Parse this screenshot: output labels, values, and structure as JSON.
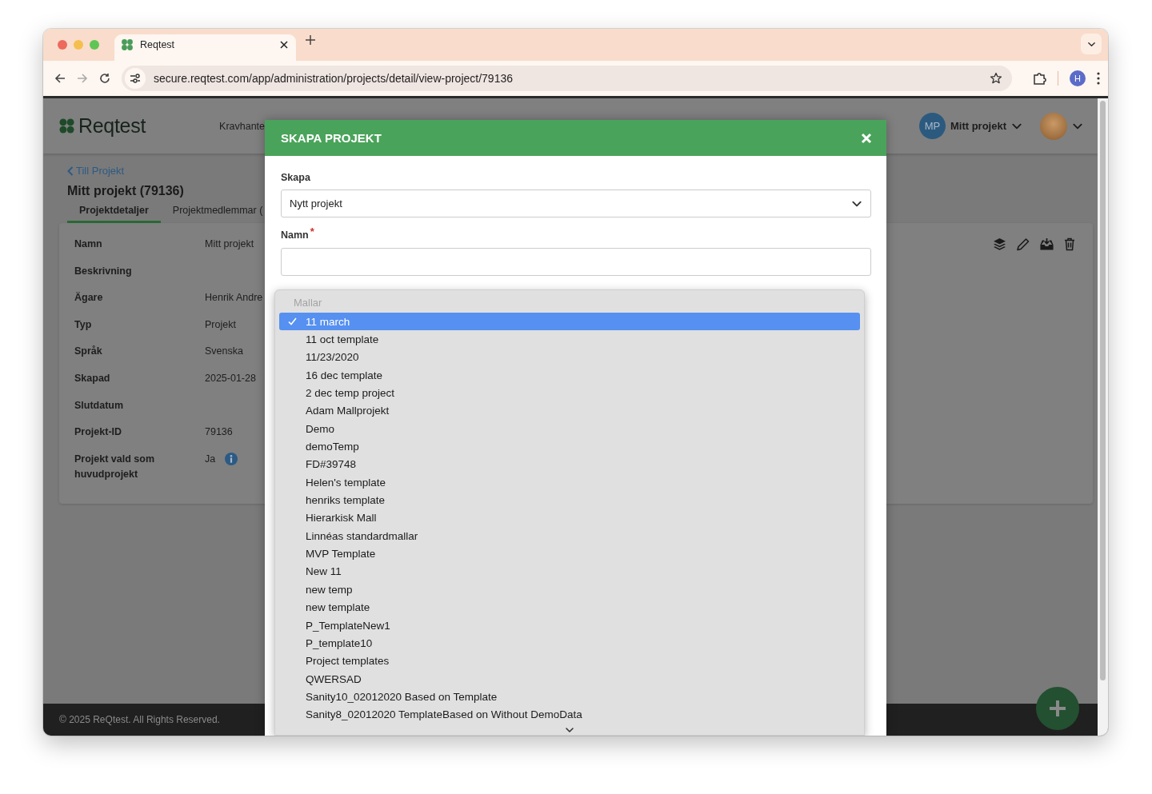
{
  "browser": {
    "tab_title": "Reqtest",
    "url": "secure.reqtest.com/app/administration/projects/detail/view-project/79136",
    "profile_initial": "H"
  },
  "header": {
    "logo": "Reqtest",
    "nav_item": "Kravhante",
    "project_initials": "MP",
    "project_name": "Mitt projekt"
  },
  "back_link": "Till Projekt",
  "page_title": "Mitt projekt (79136)",
  "tabs": [
    {
      "label": "Projektdetaljer",
      "selected": true
    },
    {
      "label": "Projektmedlemmar (",
      "selected": false
    }
  ],
  "details": [
    {
      "label": "Namn",
      "value": "Mitt projekt",
      "info_icon": false
    },
    {
      "label": "Beskrivning",
      "info_icon": false
    },
    {
      "label": "Ägare",
      "value": "Henrik Andre",
      "info_icon": false
    },
    {
      "label": "Typ",
      "value": "Projekt",
      "info_icon": false
    },
    {
      "label": "Språk",
      "value": "Svenska",
      "info_icon": false
    },
    {
      "label": "Skapad",
      "value": "2025-01-28",
      "info_icon": false
    },
    {
      "label": "Slutdatum",
      "info_icon": false
    },
    {
      "label": "Projekt-ID",
      "value": "79136",
      "info_icon": false
    },
    {
      "label": "Projekt vald som huvudprojekt",
      "value": "Ja",
      "info_icon": true
    }
  ],
  "footer": "© 2025 ReQtest. All Rights Reserved.",
  "modal": {
    "title": "SKAPA PROJEKT",
    "fields": [
      {
        "kind": "select",
        "label": "Skapa",
        "value": "Nytt projekt"
      },
      {
        "kind": "text",
        "label": "Namn",
        "required_mark": "*"
      }
    ]
  },
  "dropdown": {
    "group_label": "Mallar",
    "options": [
      {
        "label": "11 march",
        "selected": true
      },
      {
        "label": "11 oct template",
        "selected": false
      },
      {
        "label": "11/23/2020",
        "selected": false
      },
      {
        "label": "16 dec template",
        "selected": false
      },
      {
        "label": "2 dec temp project",
        "selected": false
      },
      {
        "label": "Adam Mallprojekt",
        "selected": false
      },
      {
        "label": "Demo",
        "selected": false
      },
      {
        "label": "demoTemp",
        "selected": false
      },
      {
        "label": "FD#39748",
        "selected": false
      },
      {
        "label": "Helen's template",
        "selected": false
      },
      {
        "label": "henriks template",
        "selected": false
      },
      {
        "label": "Hierarkisk Mall",
        "selected": false
      },
      {
        "label": "Linnéas standardmallar",
        "selected": false
      },
      {
        "label": "MVP Template",
        "selected": false
      },
      {
        "label": "New 11",
        "selected": false
      },
      {
        "label": "new temp",
        "selected": false
      },
      {
        "label": "new template",
        "selected": false
      },
      {
        "label": "P_TemplateNew1",
        "selected": false
      },
      {
        "label": "P_template10",
        "selected": false
      },
      {
        "label": "Project templates",
        "selected": false
      },
      {
        "label": "QWERSAD",
        "selected": false
      },
      {
        "label": "Sanity10_02012020 Based on Template",
        "selected": false
      },
      {
        "label": "Sanity8_02012020 TemplateBased on Without DemoData",
        "selected": false
      }
    ]
  }
}
